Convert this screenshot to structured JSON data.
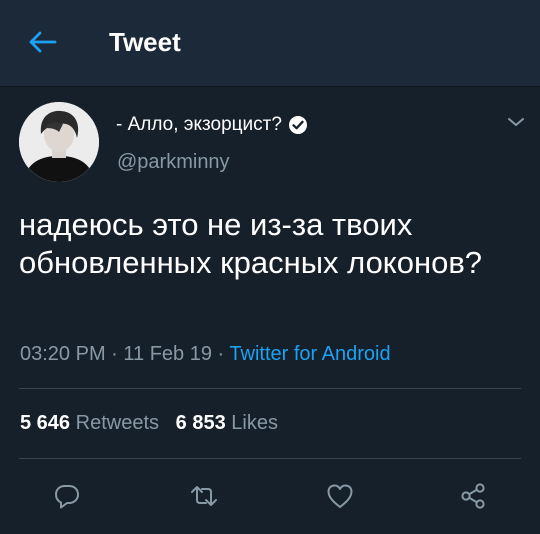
{
  "header": {
    "title": "Tweet",
    "back_icon": "arrow-left-icon"
  },
  "tweet": {
    "display_name": "- Алло, экзорцист?",
    "verified": true,
    "username": "@parkminny",
    "text": "надеюсь это не из-за твоих обновленных красных локонов?",
    "time": "03:20 PM",
    "date": "11 Feb 19",
    "source": "Twitter for Android",
    "retweets_count": "5 646",
    "retweets_label": "Retweets",
    "likes_count": "6 853",
    "likes_label": "Likes"
  },
  "actions": [
    "reply-icon",
    "retweet-icon",
    "like-icon",
    "share-icon"
  ],
  "colors": {
    "background": "#16202b",
    "header": "#1c2938",
    "accent": "#1da1f2",
    "muted": "#8899a6",
    "divider": "#38444d"
  }
}
